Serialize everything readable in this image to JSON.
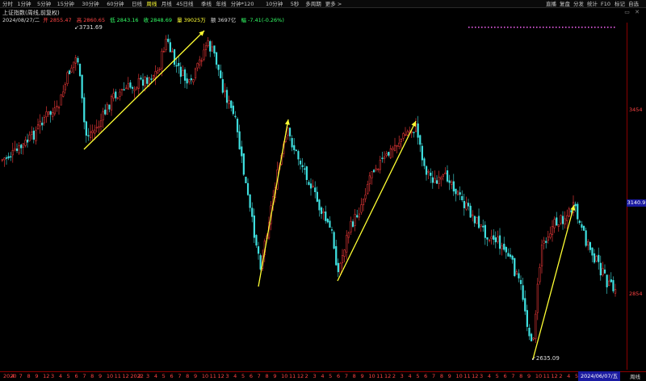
{
  "toolbar": {
    "timeframes": [
      "分时",
      "1分钟",
      "5分钟",
      "15分钟",
      "30分钟",
      "60分钟",
      "日线",
      "周线",
      "月线",
      "45日线",
      "季线",
      "年线",
      "分钟*120",
      "10分钟",
      "5秒",
      "多周期",
      "更多 >"
    ],
    "active_timeframe": "周线",
    "right_buttons": [
      "直播",
      "复盘",
      "分发",
      "统计",
      "F10",
      "标记",
      "自选"
    ]
  },
  "header": {
    "index_name": "上证指数(周线,前复权)",
    "date": "2024/08/27/二",
    "open_label": "开",
    "open": "2855.47",
    "high_label": "高",
    "high": "2860.65",
    "low_label": "低",
    "low": "2843.16",
    "close_label": "收",
    "close": "2848.69",
    "volume_label": "量",
    "volume": "39025万",
    "amount_label": "额",
    "amount": "3697亿",
    "change_label": "幅",
    "change": "-7.41(-0.26%)"
  },
  "annotations": {
    "high_marker": "3731.69",
    "low_marker": "2635.09"
  },
  "price_axis": {
    "labels": [
      "3454",
      "2854"
    ],
    "current": "3140.9"
  },
  "date_axis": {
    "labels": [
      "2020",
      "4",
      "7",
      "8",
      "9",
      "12",
      "3",
      "4",
      "5",
      "6",
      "7",
      "8",
      "9",
      "10",
      "11",
      "12",
      "2022",
      "2",
      "3",
      "4",
      "5",
      "6",
      "7",
      "8",
      "9",
      "10",
      "11",
      "12",
      "3",
      "4",
      "5",
      "6",
      "7",
      "8",
      "9",
      "10",
      "11",
      "12",
      "2",
      "3",
      "4",
      "5",
      "6",
      "7",
      "8",
      "9",
      "10",
      "11",
      "12",
      "2",
      "3",
      "4",
      "5",
      "6",
      "7",
      "8",
      "9",
      "10",
      "11",
      "12",
      "3",
      "4",
      "5",
      "6",
      "7",
      "8",
      "9",
      "10",
      "11",
      "12",
      "2",
      "4",
      "5"
    ],
    "current": "2024/06/07/五",
    "period": "周线"
  },
  "colors": {
    "up": "#ff3c3c",
    "down": "#3fe0e0",
    "trend": "#ffff33",
    "background": "#000000",
    "axis": "#8b0000"
  }
}
